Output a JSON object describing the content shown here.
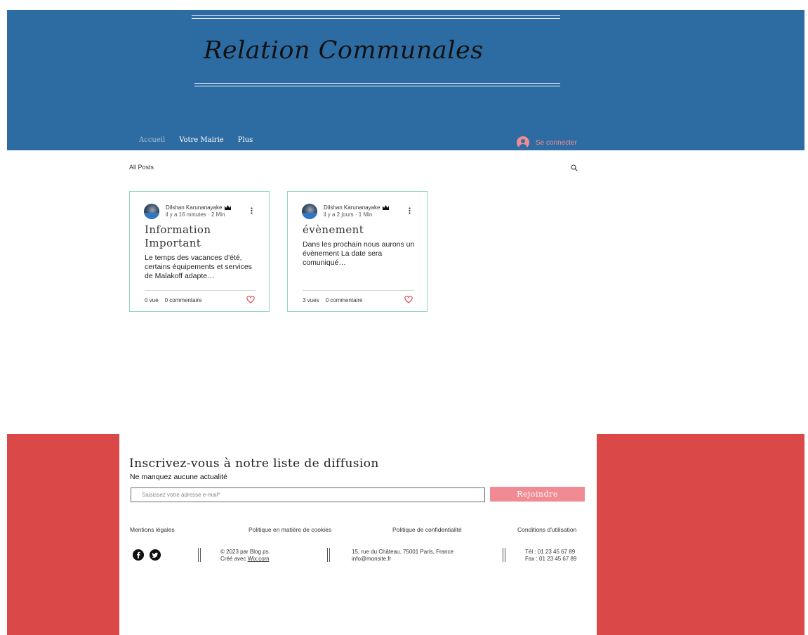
{
  "header": {
    "site_title": "Relation Communales",
    "nav": [
      {
        "label": "Accueil"
      },
      {
        "label": "Votre Mairie"
      },
      {
        "label": "Plus"
      }
    ],
    "login_label": "Se connecter",
    "colors": {
      "background": "#2d6ca2",
      "accent": "#f08b93"
    }
  },
  "blog": {
    "all_posts_label": "All Posts",
    "posts": [
      {
        "author": "Dilshan Karunanayake",
        "time": "il y a 16 minutes",
        "read_time": "2 Min",
        "title": "Information Important",
        "excerpt": "Le temps des vacances d'été, certains équipements et services de Malakoff adapte…",
        "views": "0 vue",
        "comments": "0 commentaire"
      },
      {
        "author": "Dilshan Karunanayake",
        "time": "il y a 2 jours",
        "read_time": "1 Min",
        "title": "évènement",
        "excerpt": "Dans les prochain nous aurons un évènement La date sera comuniqué…",
        "views": "3 vues",
        "comments": "0 commentaire"
      }
    ]
  },
  "footer": {
    "newsletter_title": "Inscrivez-vous à notre liste de diffusion",
    "newsletter_subtitle": "Ne manquez aucune actualité",
    "email_placeholder": "Saisissez votre adresse e-mail*",
    "join_label": "Rejoindre",
    "links": [
      {
        "label": "Mentions légales"
      },
      {
        "label": "Politique en matière de cookies"
      },
      {
        "label": "Politique de confidentialité"
      },
      {
        "label": "Conditions d'utilisation"
      }
    ],
    "copyright": "© 2023 par Blog ps.",
    "created_with": "Créé avec",
    "wix_link": "Wix.com",
    "address": "15, rue du Château. 75001 Paris, France",
    "email": "info@monsite.fr",
    "phone": "Tél : 01 23 45 67 89",
    "fax": "Fax : 01 23 45 67 89",
    "colors": {
      "side_panels": "#db4848"
    }
  }
}
